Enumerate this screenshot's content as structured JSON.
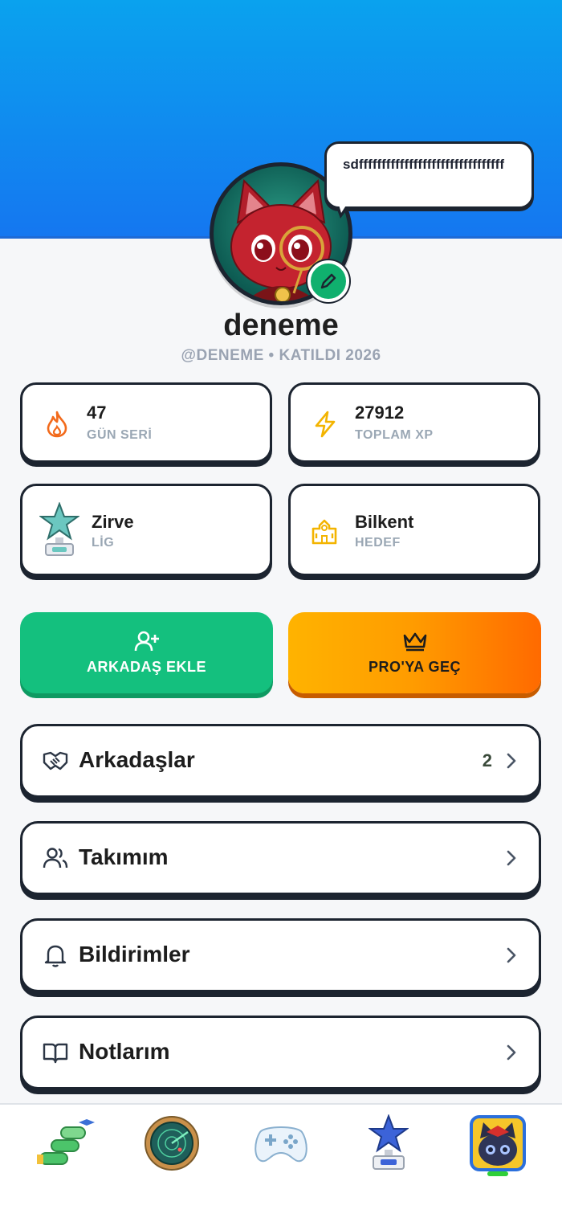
{
  "profile": {
    "speech_text": "sdffffffffffffffffffffffffffffffff",
    "name": "deneme",
    "handle_line": "@DENEME • KATILDI 2026"
  },
  "stats": [
    {
      "value": "47",
      "label": "GÜN SERİ",
      "icon": "flame-icon",
      "color": "#f26a1b"
    },
    {
      "value": "27912",
      "label": "TOPLAM XP",
      "icon": "lightning-icon",
      "color": "#f3b400"
    },
    {
      "value": "Zirve",
      "label": "LİG",
      "icon": "league-trophy-icon",
      "color": "#6bc7c0"
    },
    {
      "value": "Bilkent",
      "label": "HEDEF",
      "icon": "school-building-icon",
      "color": "#f3b400"
    }
  ],
  "actions": {
    "add_friend": "ARKADAŞ EKLE",
    "go_pro": "PRO'YA GEÇ"
  },
  "menu": [
    {
      "label": "Arkadaşlar",
      "count": "2",
      "icon": "handshake-icon"
    },
    {
      "label": "Takımım",
      "count": "",
      "icon": "users-icon"
    },
    {
      "label": "Bildirimler",
      "count": "",
      "icon": "bell-icon"
    },
    {
      "label": "Notlarım",
      "count": "",
      "icon": "book-icon"
    }
  ],
  "bottom_nav": [
    {
      "icon": "learning-path-icon",
      "active": false
    },
    {
      "icon": "radar-icon",
      "active": false
    },
    {
      "icon": "gamepad-icon",
      "active": false
    },
    {
      "icon": "trophy-star-icon",
      "active": false
    },
    {
      "icon": "profile-cat-icon",
      "active": true
    }
  ],
  "colors": {
    "banner_top": "#0aa2ee",
    "banner_bottom": "#1577f0",
    "green": "#14c07e",
    "orange": "#ff9b00"
  }
}
